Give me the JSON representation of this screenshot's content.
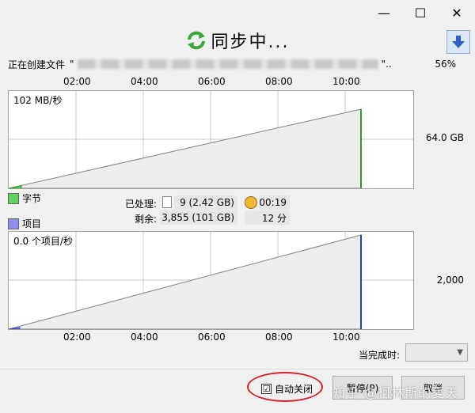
{
  "window": {
    "minimize": "—",
    "maximize": "☐",
    "close": "✕"
  },
  "title": {
    "text": "同步中...",
    "icon": "sync-icon"
  },
  "status": {
    "prefix": "正在创建文件",
    "quote_open": "\"",
    "quote_close": "\"..",
    "percent": "56%"
  },
  "time_ticks": [
    "02:00",
    "04:00",
    "06:00",
    "08:00",
    "10:00"
  ],
  "bytes_chart": {
    "rate_label": "102 MB/秒",
    "right_value": "64.0 GB",
    "legend": "字节",
    "color": "#2d9c2d"
  },
  "items_chart": {
    "rate_label": "0.0 个项目/秒",
    "right_value": "2,000",
    "legend": "项目",
    "color": "#4a4ad0"
  },
  "stats": {
    "processed_label": "已处理:",
    "processed_value": "9 (2.42 GB)",
    "remaining_label": "剩余:",
    "remaining_value": "3,855 (101 GB)",
    "elapsed": "00:19",
    "remaining_time": "12 分"
  },
  "eta": {
    "label": "当完成时:",
    "value": ""
  },
  "footer": {
    "auto_close_label": "自动关闭",
    "auto_close_checked": "☑",
    "pause_label": "暂停(P)",
    "cancel_label": "取消",
    "watermark": "知乎 @柯林斯的夏天"
  }
}
